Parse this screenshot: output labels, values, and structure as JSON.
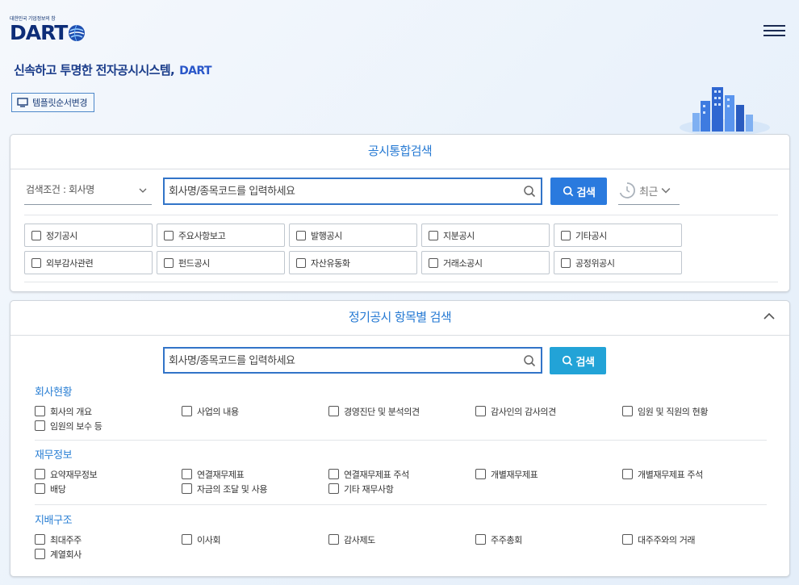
{
  "header": {
    "logo_tagline": "대한민국 기업정보의 창",
    "logo_text": "DART",
    "tagline": "신속하고 투명한 전자공시시스템,",
    "tagline_brand": "DART",
    "template_button": "템플릿순서변경"
  },
  "integrated_search": {
    "title": "공시통합검색",
    "condition_select": "검색조건 : 회사명",
    "search_placeholder": "회사명/종목코드를 입력하세요",
    "search_button": "검색",
    "recent_label": "최근",
    "categories": [
      "정기공시",
      "주요사항보고",
      "발행공시",
      "지분공시",
      "기타공시",
      "외부감사관련",
      "펀드공시",
      "자산유동화",
      "거래소공시",
      "공정위공시"
    ]
  },
  "periodic_search": {
    "title": "정기공시 항목별 검색",
    "search_placeholder": "회사명/종목코드를 입력하세요",
    "search_button": "검색",
    "sections": [
      {
        "title": "회사현황",
        "items": [
          "회사의 개요",
          "사업의 내용",
          "경영진단 및 분석의견",
          "감사인의 감사의견",
          "임원 및 직원의 현황",
          "임원의 보수 등"
        ]
      },
      {
        "title": "재무정보",
        "items": [
          "요약재무정보",
          "연결재무제표",
          "연결재무제표 주석",
          "개별재무제표",
          "개별재무제표 주석",
          "배당",
          "자금의 조달 및 사용",
          "기타 재무사항"
        ]
      },
      {
        "title": "지배구조",
        "items": [
          "최대주주",
          "이사회",
          "감사제도",
          "주주총회",
          "대주주와의 거래",
          "계열회사"
        ]
      }
    ]
  },
  "colors": {
    "accent": "#2a7ade",
    "title_blue": "#2579d3",
    "search_teal": "#22a3d7",
    "brand_navy": "#0d2d78"
  }
}
